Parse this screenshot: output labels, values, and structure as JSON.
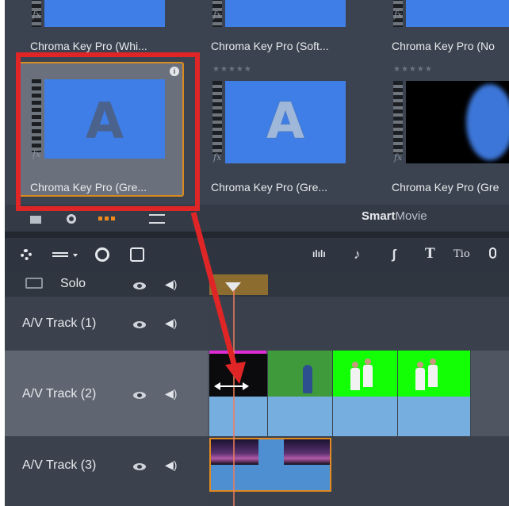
{
  "library": {
    "top_row": [
      {
        "label": "Chroma Key Pro (Whi..."
      },
      {
        "label": "Chroma Key Pro (Soft..."
      },
      {
        "label": "Chroma Key Pro (No"
      }
    ],
    "bottom_row": [
      {
        "label": "Chroma Key Pro (Gre...",
        "thumb_text": "A",
        "selected": true
      },
      {
        "label": "Chroma Key Pro (Gre...",
        "thumb_text": "A",
        "rating": "★★★★★"
      },
      {
        "label": "Chroma Key Pro (Gre",
        "rating": "★★★★★"
      }
    ],
    "fx_glyph": "fx",
    "info_glyph": "i",
    "smartmovie_bold": "Smart",
    "smartmovie_rest": "Movie"
  },
  "timeline_toolbar": {
    "icons": [
      "settings-icon",
      "list-icon",
      "record-icon",
      "stack-icon",
      "audio-levels-icon",
      "music-note-icon",
      "script-icon",
      "title-icon",
      "title-small-icon",
      "microphone-icon"
    ],
    "glyphs": {
      "levels": "ılılı",
      "note": "♪",
      "script": "ʃ",
      "title": "T",
      "title_small": "Tio",
      "mic": "🎙"
    }
  },
  "tracks": [
    {
      "name": "Solo"
    },
    {
      "name": "A/V Track (1)"
    },
    {
      "name": "A/V Track (2)"
    },
    {
      "name": "A/V Track (3)"
    }
  ],
  "colors": {
    "selection_orange": "#d98a1f",
    "annotation_red": "#e02527",
    "magenta_marker": "#e02bd6",
    "green_screen": "#12ff06",
    "clip_blue": "#76aee0"
  }
}
